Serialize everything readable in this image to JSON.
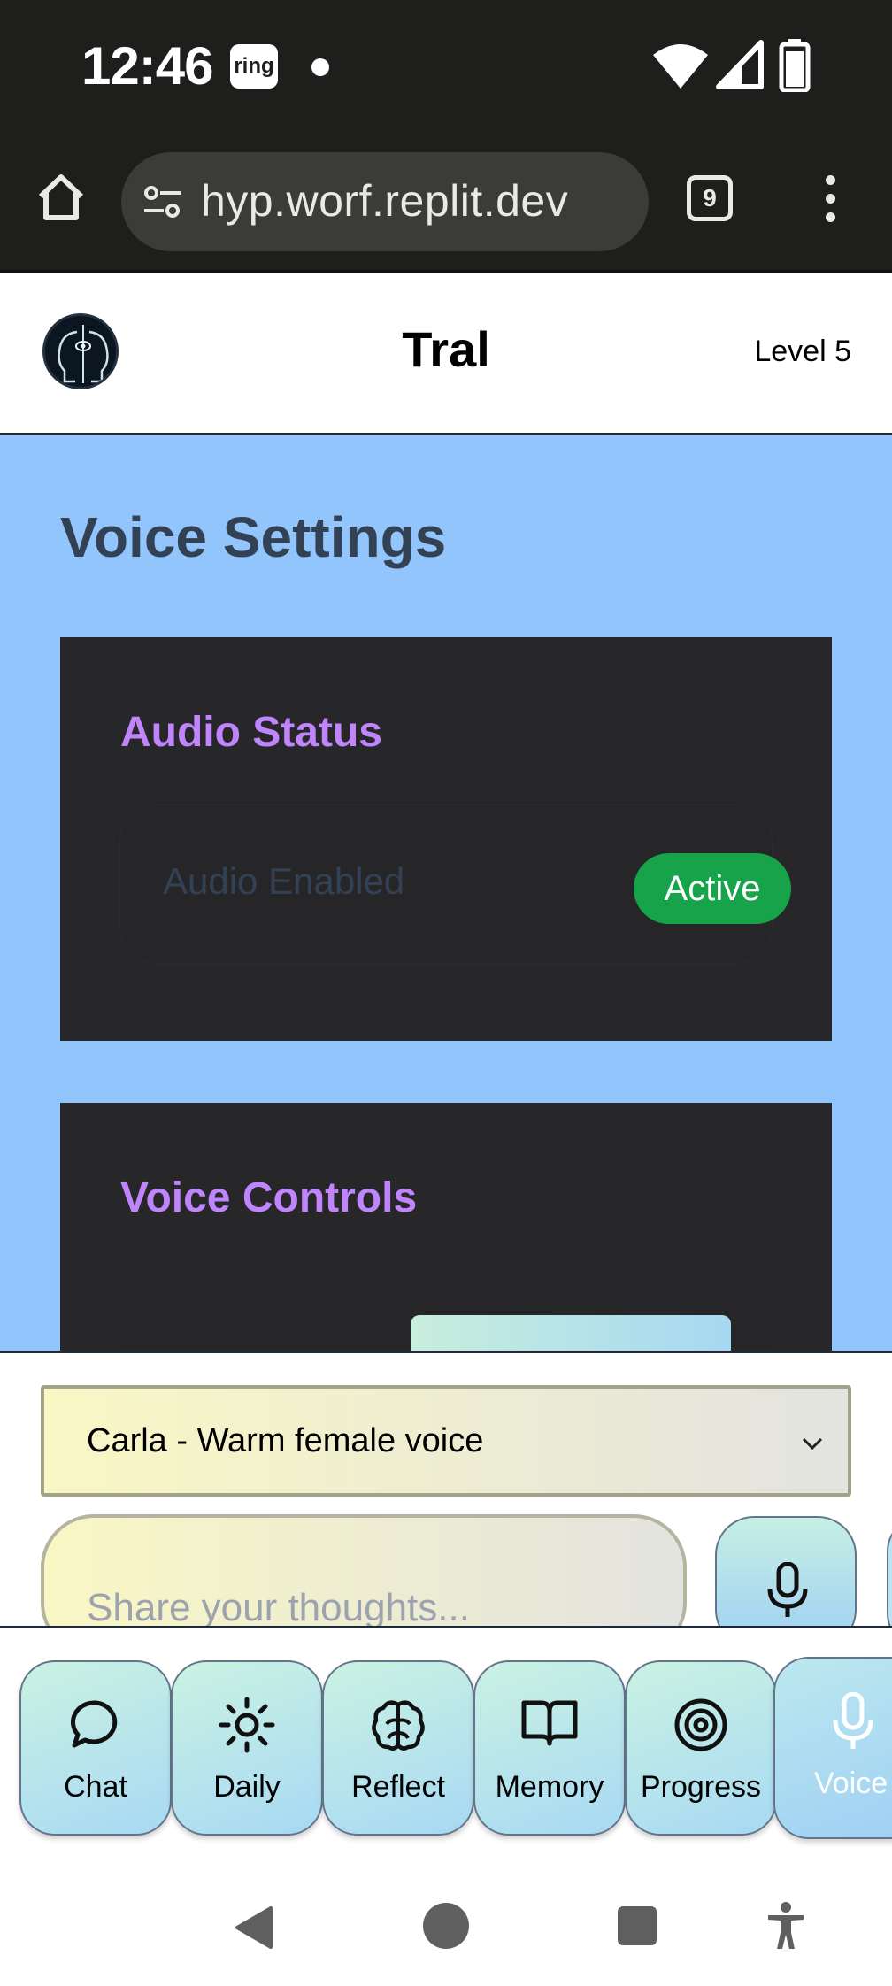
{
  "status_bar": {
    "time": "12:46",
    "ring_badge": "ring",
    "icons": [
      "notification-dot-icon",
      "wifi-icon",
      "cell-signal-icon",
      "battery-icon"
    ]
  },
  "browser": {
    "url": "hyp.worf.replit.dev",
    "tab_count": "9",
    "icons": [
      "home-icon",
      "site-settings-icon",
      "tab-switcher-icon",
      "more-vert-icon"
    ]
  },
  "header": {
    "title": "Tral",
    "level": "Level 5",
    "logo_icon": "twin-heads-eye-logo"
  },
  "main": {
    "page_title": "Voice Settings",
    "audio_card": {
      "title": "Audio Status",
      "row_label": "Audio Enabled",
      "badge": "Active",
      "badge_color": "#16a34a"
    },
    "voice_card": {
      "title": "Voice Controls"
    }
  },
  "composer": {
    "voice_select_value": "Carla - Warm female voice",
    "input_placeholder": "Share your thoughts...",
    "mic_icon": "microphone-icon"
  },
  "nav_tabs": [
    {
      "label": "Chat",
      "icon": "chat-bubble-icon"
    },
    {
      "label": "Daily",
      "icon": "sun-icon"
    },
    {
      "label": "Reflect",
      "icon": "brain-icon"
    },
    {
      "label": "Memory",
      "icon": "open-book-icon"
    },
    {
      "label": "Progress",
      "icon": "target-icon"
    },
    {
      "label": "Voice",
      "icon": "microphone-icon"
    }
  ],
  "colors": {
    "main_bg": "#93c5fd",
    "card_bg": "#27272a",
    "card_title": "#c084fc",
    "page_title": "#334155"
  }
}
